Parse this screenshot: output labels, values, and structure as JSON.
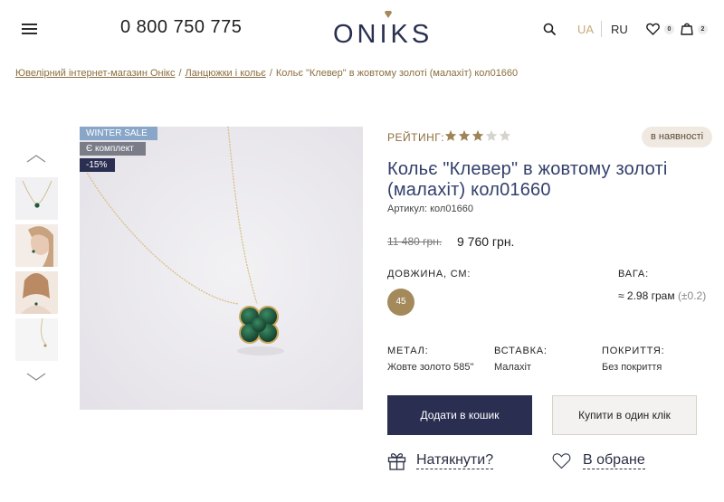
{
  "header": {
    "phone": "0 800 750 775",
    "logo": "ONIKS",
    "lang_ua": "UA",
    "lang_ru": "RU",
    "favorites_count": "0",
    "cart_count": "2"
  },
  "breadcrumb": {
    "items": [
      "Ювелірний інтернет-магазин Онікс",
      "Ланцюжки і кольє"
    ],
    "current": "Кольє \"Клевер\" в жовтому золоті (малахіт) кол01660",
    "separator": "/"
  },
  "tags": {
    "sale": "WINTER SALE",
    "kit": "Є комплект",
    "discount": "-15%"
  },
  "product": {
    "rating_label": "РЕЙТИНГ:",
    "rating": 3,
    "rating_max": 5,
    "stock": "в наявності",
    "title": "Кольє \"Клевер\" в жовтому золоті (малахіт) кол01660",
    "sku": "Артикул: кол01660",
    "old_price": "11 480 грн.",
    "new_price": "9 760 грн.",
    "length_label": "ДОВЖИНА, СМ:",
    "length_value": "45",
    "weight_label": "ВАГА:",
    "weight_value": "≈ 2.98 грам",
    "weight_tolerance": "(±0.2)",
    "specs": [
      {
        "label": "МЕТАЛ:",
        "value": "Жовте золото 585\""
      },
      {
        "label": "ВСТАВКА:",
        "value": "Малахіт"
      },
      {
        "label": "ПОКРИТТЯ:",
        "value": "Без покриття"
      }
    ],
    "add_to_cart": "Додати в кошик",
    "buy_one_click": "Купити в один клік",
    "hint": "Натякнути?",
    "favorite": "В обране"
  },
  "colors": {
    "navy": "#2a2f52",
    "gold": "#a48a5b",
    "accent_text": "#8c6e3f",
    "malachite": "#1f5a3e"
  },
  "icons": [
    "menu-icon",
    "search-icon",
    "heart-icon",
    "bag-icon",
    "chevron-up-icon",
    "chevron-down-icon",
    "star-icon",
    "gift-icon"
  ]
}
